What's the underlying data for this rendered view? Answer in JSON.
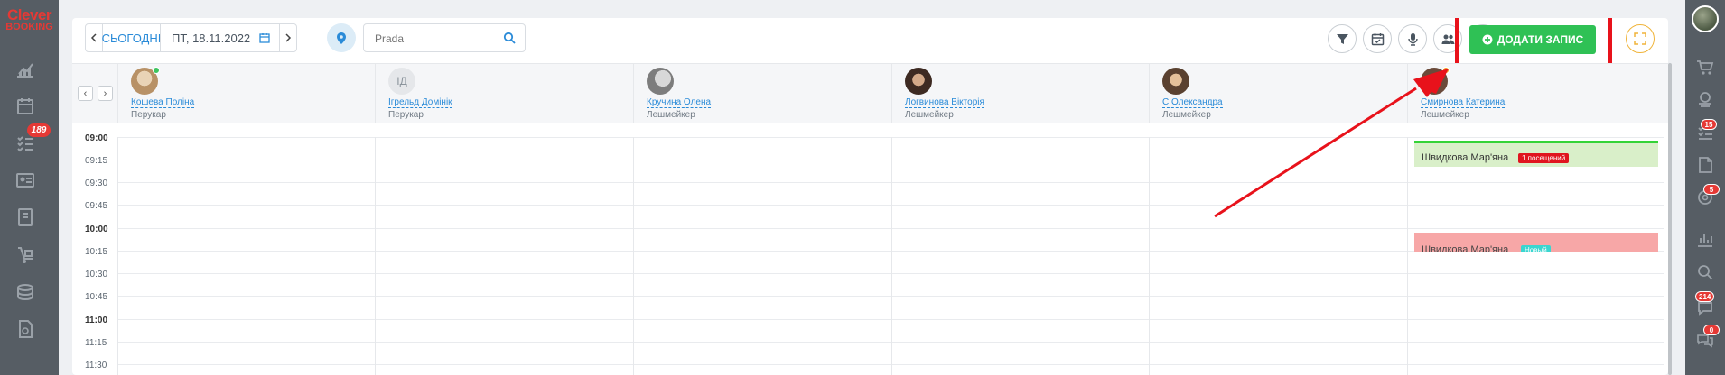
{
  "brand": {
    "line1": "Clever",
    "line2": "BOOKING"
  },
  "left_sidebar": {
    "items": [
      {
        "icon": "chart-icon"
      },
      {
        "icon": "calendar-icon"
      },
      {
        "icon": "tasks-icon",
        "badge": "189"
      },
      {
        "icon": "id-card-icon"
      },
      {
        "icon": "book-icon"
      },
      {
        "icon": "dolly-icon"
      },
      {
        "icon": "coins-icon"
      },
      {
        "icon": "document-icon"
      }
    ]
  },
  "toolbar": {
    "today_label": "СЬОГОДНІ",
    "date_label": "ПТ, 18.11.2022",
    "search_placeholder": "Prada",
    "add_label": "ДОДАТИ ЗАПИС"
  },
  "staff": [
    {
      "name": "Кошева Поліна",
      "role": "Перукар",
      "avatar": "photo",
      "status": "online"
    },
    {
      "name": "Ігрельд Домінік",
      "role": "Перукар",
      "avatar": "initials",
      "initials": "ІД"
    },
    {
      "name": "Кручина Олена",
      "role": "Лешмейкер",
      "avatar": "photo"
    },
    {
      "name": "Логвинова Вікторія",
      "role": "Лешмейкер",
      "avatar": "photo"
    },
    {
      "name": "С Олександра",
      "role": "Лешмейкер",
      "avatar": "photo"
    },
    {
      "name": "Смирнова Катерина",
      "role": "Лешмейкер",
      "avatar": "photo",
      "status": "busy"
    }
  ],
  "times": [
    "09:00",
    "09:15",
    "09:30",
    "09:45",
    "10:00",
    "10:15",
    "10:30",
    "10:45",
    "11:00",
    "11:15",
    "11:30"
  ],
  "events": [
    {
      "client": "Швидкова Мар'яна",
      "badge": "1 посещений",
      "staff": "Смирнова Катерина",
      "start": "09:15",
      "color": "#d9efc9"
    },
    {
      "client": "Швидкова Мар'яна",
      "badge": "Новый",
      "staff": "Смирнова Катерина",
      "start": "10:15",
      "color": "#f7a7a7"
    }
  ],
  "right_sidebar": {
    "items": [
      {
        "icon": "cart-icon"
      },
      {
        "icon": "coins-icon"
      },
      {
        "icon": "tasks-icon",
        "badge": "15"
      },
      {
        "icon": "note-icon"
      },
      {
        "icon": "bell-at-icon",
        "badge": "5"
      },
      {
        "icon": "bar-chart-icon"
      },
      {
        "icon": "search-icon"
      },
      {
        "icon": "chat-icon",
        "badge": "214"
      },
      {
        "icon": "messages-icon",
        "badge": "0"
      }
    ]
  },
  "colors": {
    "accent": "#2a8bd8",
    "add_button": "#2fc155",
    "highlight": "#e8121b",
    "sidebar": "#565d64"
  }
}
